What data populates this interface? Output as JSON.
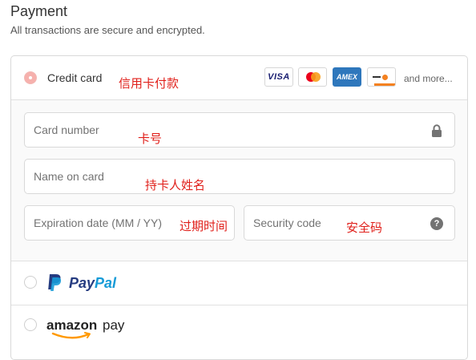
{
  "header": {
    "title": "Payment",
    "subtitle": "All transactions are secure and encrypted."
  },
  "credit_card": {
    "label": "Credit card",
    "selected": true,
    "annotation": "信用卡付款",
    "brands": [
      "VISA",
      "mastercard",
      "AMEX",
      "discover"
    ],
    "brand_visa": "VISA",
    "brand_amex": "AMEX",
    "more_text": "and more...",
    "fields": {
      "card_number": {
        "placeholder": "Card number",
        "value": "",
        "annotation": "卡号",
        "icon": "lock-icon"
      },
      "name": {
        "placeholder": "Name on card",
        "value": "",
        "annotation": "持卡人姓名"
      },
      "expiration": {
        "placeholder": "Expiration date (MM / YY)",
        "value": "",
        "annotation": "过期时间"
      },
      "security": {
        "placeholder": "Security code",
        "value": "",
        "annotation": "安全码",
        "icon": "help-icon",
        "help_symbol": "?"
      }
    }
  },
  "paypal": {
    "logo_pay": "Pay",
    "logo_pal": "Pal",
    "selected": false
  },
  "amazon": {
    "logo_word": "amazon",
    "logo_pay": "pay",
    "selected": false
  },
  "colors": {
    "annotation_red": "#e0201b",
    "radio_selected": "#f6b1ad",
    "paypal_dark": "#253b80",
    "paypal_light": "#179bd7",
    "amazon_orange": "#ff9900",
    "amex_blue": "#2e77bc"
  }
}
